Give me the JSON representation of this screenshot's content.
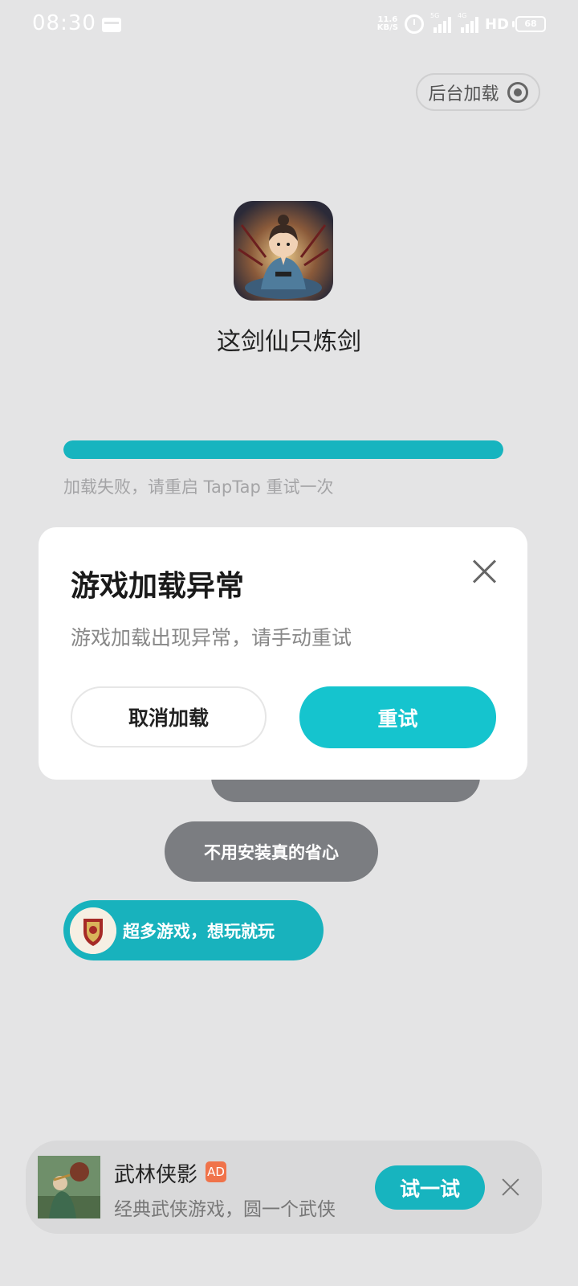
{
  "status_bar": {
    "time": "08:30",
    "net_speed_value": "11.6",
    "net_speed_unit": "KB/S",
    "signal1_label": "5G",
    "signal2_label": "4G",
    "hd_label": "HD",
    "battery": "68"
  },
  "header": {
    "background_load_label": "后台加载"
  },
  "game": {
    "title": "这剑仙只炼剑"
  },
  "loading": {
    "progress": 1.0,
    "status_text": "加载失败，请重启 TapTap 重试一次"
  },
  "bubbles": {
    "items": [
      {
        "text": "不用安装真的省心"
      },
      {
        "text": "超多游戏，想玩就玩"
      }
    ]
  },
  "modal": {
    "title": "游戏加载异常",
    "message": "游戏加载出现异常，请手动重试",
    "cancel_label": "取消加载",
    "retry_label": "重试"
  },
  "ad": {
    "title": "武林侠影",
    "badge": "AD",
    "description": "经典武侠游戏，圆一个武侠",
    "cta_label": "试一试"
  },
  "colors": {
    "accent": "#17b4bf",
    "retry_button": "#15c4ce",
    "background": "#e4e4e5",
    "ad_badge": "#f0734a"
  }
}
